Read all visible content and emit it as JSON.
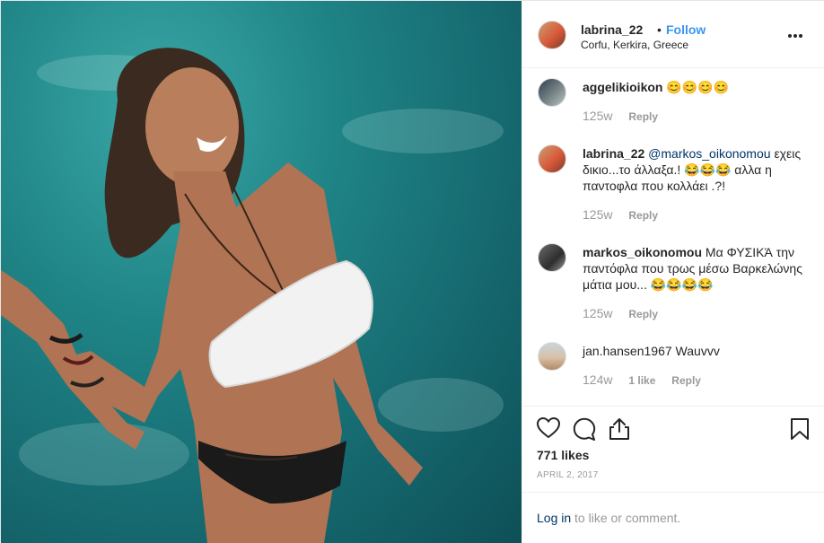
{
  "header": {
    "username": "labrina_22",
    "separator": "•",
    "follow_label": "Follow",
    "location": "Corfu, Kerkira, Greece"
  },
  "comments": [
    {
      "username": "aggelikioikon",
      "mention": "",
      "text": "😊😊😊😊",
      "time": "125w",
      "likes": "",
      "reply": "Reply"
    },
    {
      "username": "labrina_22",
      "mention": "@markos_oikonomou",
      "text": "εχεις δικιο...το άλλαξα.! 😂😂😂 αλλα η παντοφλα που κολλάει .?!",
      "time": "125w",
      "likes": "",
      "reply": "Reply"
    },
    {
      "username": "markos_oikonomou",
      "mention": "",
      "text": "Μα ΦΥΣΙΚΆ την παντόφλα που τρως μέσω Βαρκελώνης μάτια μου... 😂😂😂😂",
      "time": "125w",
      "likes": "",
      "reply": "Reply"
    },
    {
      "username": "jan.hansen1967",
      "mention": "",
      "text": "Wauvvv",
      "time": "124w",
      "likes": "1 like",
      "reply": "Reply"
    }
  ],
  "actions": {
    "like_icon": "heart-icon",
    "comment_icon": "comment-icon",
    "share_icon": "share-icon",
    "save_icon": "bookmark-icon",
    "likes_count": "771 likes",
    "date": "APRIL 2, 2017"
  },
  "login_prompt": {
    "link": "Log in",
    "rest": " to like or comment."
  },
  "colors": {
    "link_blue": "#3897f0",
    "dark_link": "#003569",
    "muted": "#999999",
    "water": "#1f8486"
  }
}
